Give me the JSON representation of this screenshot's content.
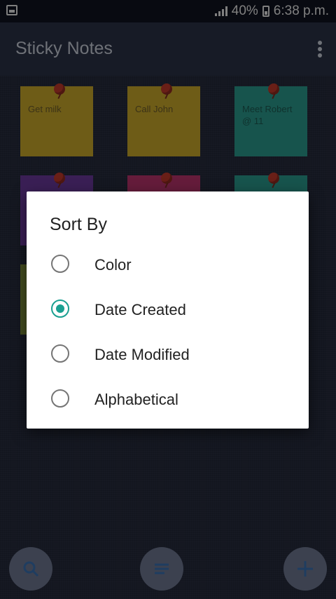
{
  "status_bar": {
    "battery": "40%",
    "time": "6:38 p.m."
  },
  "app_bar": {
    "title": "Sticky Notes"
  },
  "notes": [
    {
      "text": "Get milk",
      "color": "#c9a82a"
    },
    {
      "text": "Call John",
      "color": "#c9a82a"
    },
    {
      "text": "Meet Robert @ 11",
      "color": "#2a9a8c"
    },
    {
      "text": "",
      "color": "#6a3a9c"
    },
    {
      "text": "",
      "color": "#b8336c"
    },
    {
      "text": "",
      "color": "#2a9a8c"
    },
    {
      "text": "",
      "color": "#7a8a3a"
    }
  ],
  "dialog": {
    "title": "Sort By",
    "options": [
      {
        "label": "Color",
        "selected": false
      },
      {
        "label": "Date Created",
        "selected": true
      },
      {
        "label": "Date Modified",
        "selected": false
      },
      {
        "label": "Alphabetical",
        "selected": false
      }
    ]
  },
  "colors": {
    "accent": "#1aa091",
    "app_bar": "#2b3246",
    "fab": "#6d7790"
  },
  "bottom_bar": {
    "icons": [
      "search-icon",
      "list-icon",
      "plus-icon"
    ]
  }
}
